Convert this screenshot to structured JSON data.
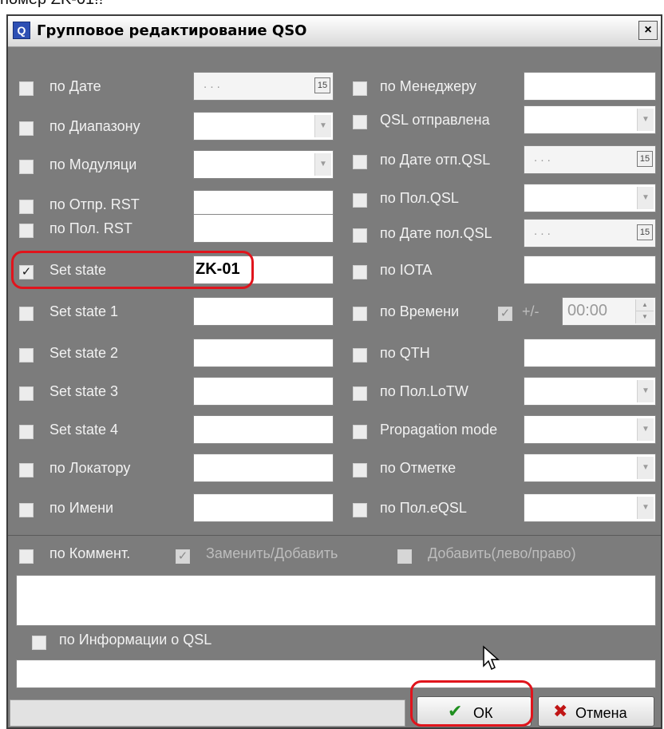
{
  "page_header_text": "номер ZK-01!!",
  "window": {
    "title": "Групповое редактирование QSO",
    "close_glyph": "×",
    "icon_letter": "Q"
  },
  "left_fields": [
    {
      "label": "по Дате",
      "checked": false,
      "type": "date",
      "value": ". . ."
    },
    {
      "label": "по Диапазону",
      "checked": false,
      "type": "dropdown",
      "value": ""
    },
    {
      "label": "по Модуляци",
      "checked": false,
      "type": "dropdown",
      "value": ""
    },
    {
      "label": "по Отпр. RST",
      "checked": false,
      "type": "text",
      "value": ""
    },
    {
      "label": "по Пол. RST",
      "checked": false,
      "type": "text",
      "value": ""
    },
    {
      "label": "Set state",
      "checked": true,
      "type": "text",
      "value": "ZK-01"
    },
    {
      "label": "Set state 1",
      "checked": false,
      "type": "text",
      "value": ""
    },
    {
      "label": "Set state 2",
      "checked": false,
      "type": "text",
      "value": ""
    },
    {
      "label": "Set state 3",
      "checked": false,
      "type": "text",
      "value": ""
    },
    {
      "label": "Set state 4",
      "checked": false,
      "type": "text",
      "value": ""
    },
    {
      "label": "по Локатору",
      "checked": false,
      "type": "text",
      "value": ""
    },
    {
      "label": "по Имени",
      "checked": false,
      "type": "text",
      "value": ""
    }
  ],
  "right_fields": [
    {
      "label": "по Менеджеру",
      "checked": false,
      "type": "text",
      "value": ""
    },
    {
      "label": "QSL отправлена",
      "checked": false,
      "type": "dropdown",
      "value": ""
    },
    {
      "label": "по Дате отп.QSL",
      "checked": false,
      "type": "date",
      "value": ". . ."
    },
    {
      "label": "по Пол.QSL",
      "checked": false,
      "type": "dropdown",
      "value": ""
    },
    {
      "label": "по Дате пол.QSL",
      "checked": false,
      "type": "date",
      "value": ". . ."
    },
    {
      "label": "по IOTA",
      "checked": false,
      "type": "text",
      "value": ""
    },
    {
      "label": "по Времени",
      "checked": false,
      "type": "time",
      "value": "00:00",
      "pm_label": "+/-",
      "pm_checked": true
    },
    {
      "label": "по QTH",
      "checked": false,
      "type": "text",
      "value": ""
    },
    {
      "label": "по Пол.LoTW",
      "checked": false,
      "type": "dropdown",
      "value": ""
    },
    {
      "label": "Propagation mode",
      "checked": false,
      "type": "dropdown",
      "value": ""
    },
    {
      "label": "по Отметке",
      "checked": false,
      "type": "dropdown",
      "value": ""
    },
    {
      "label": "по Пол.eQSL",
      "checked": false,
      "type": "dropdown",
      "value": ""
    }
  ],
  "comment_section": {
    "label": "по Коммент.",
    "replace_label": "Заменить/Добавить",
    "replace_checked": true,
    "add_label": "Добавить(лево/право)",
    "add_checked": false,
    "text": ""
  },
  "qsl_info": {
    "label": "по Информации о QSL",
    "checked": false,
    "text": ""
  },
  "buttons": {
    "ok_label": "ОК",
    "cancel_label": "Отмена"
  },
  "glyphs": {
    "check": "✓",
    "calendar": "15",
    "dropdown": "▼",
    "spin_up": "▲",
    "spin_down": "▼",
    "ok_icon": "✔",
    "cancel_icon": "✖"
  },
  "colors": {
    "dialog_bg": "#7c7c7c",
    "highlight": "#e0141c",
    "ok_icon": "#1f8f1f",
    "cancel_icon": "#c01515"
  }
}
